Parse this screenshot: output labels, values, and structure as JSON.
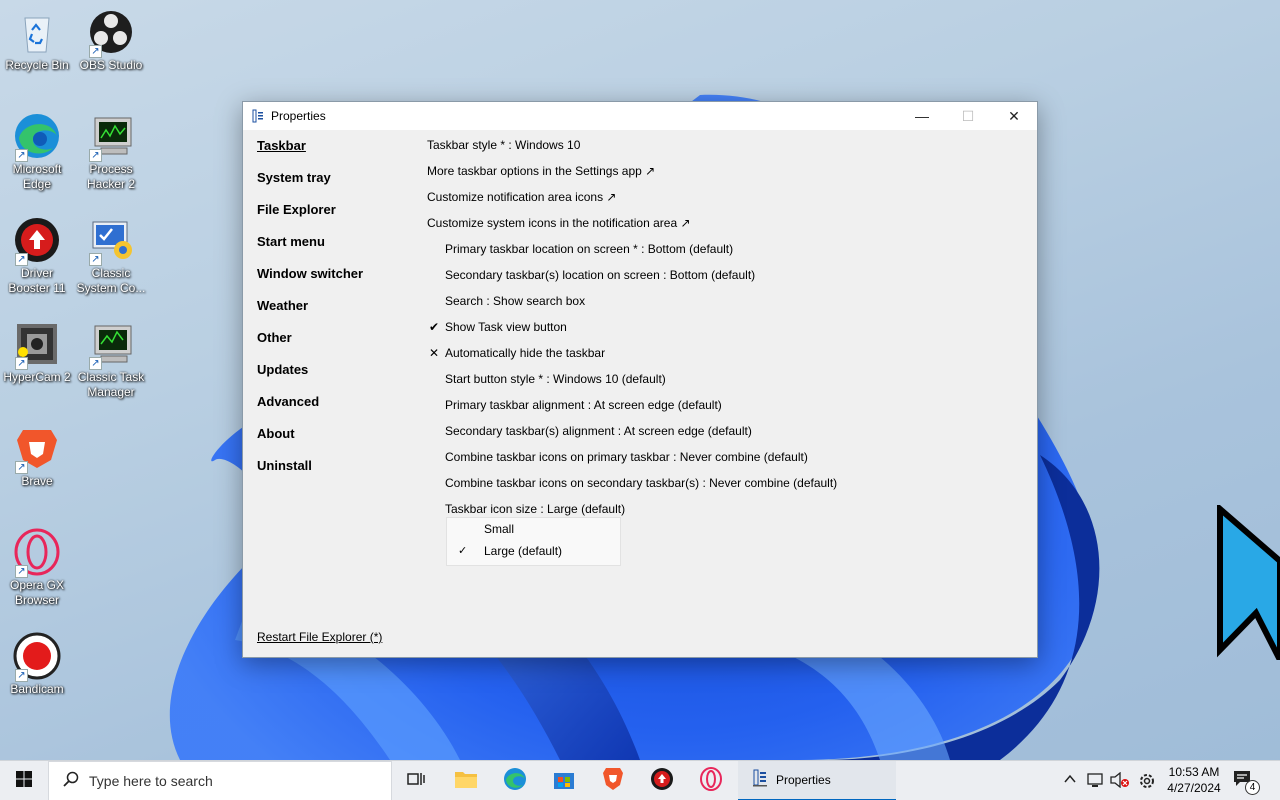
{
  "desktop": {
    "icons": [
      {
        "label": "Recycle Bin"
      },
      {
        "label": "OBS Studio"
      },
      {
        "label": "Microsoft Edge"
      },
      {
        "label": "Process Hacker 2"
      },
      {
        "label": "Driver Booster 11"
      },
      {
        "label": "Classic System Co..."
      },
      {
        "label": "HyperCam 2"
      },
      {
        "label": "Classic Task Manager"
      },
      {
        "label": "Brave"
      },
      {
        "label": "Opera GX Browser"
      },
      {
        "label": "Bandicam"
      }
    ]
  },
  "window": {
    "title": "Properties",
    "icon": "properties-app-icon",
    "controls": {
      "minimize": "—",
      "maximize": "☐",
      "close": "✕"
    },
    "nav": [
      {
        "label": "Taskbar",
        "active": true
      },
      {
        "label": "System tray"
      },
      {
        "label": "File Explorer"
      },
      {
        "label": "Start menu"
      },
      {
        "label": "Window switcher"
      },
      {
        "label": "Weather"
      },
      {
        "label": "Other"
      },
      {
        "label": "Updates"
      },
      {
        "label": "Advanced"
      },
      {
        "label": "About"
      },
      {
        "label": "Uninstall"
      }
    ],
    "settings": [
      {
        "label": "Taskbar style * : Windows 10"
      },
      {
        "label": "More taskbar options in the Settings app ↗"
      },
      {
        "label": "Customize notification area icons ↗"
      },
      {
        "label": "Customize system icons in the notification area ↗"
      },
      {
        "label": "Primary taskbar location on screen * : Bottom (default)"
      },
      {
        "label": "Secondary taskbar(s) location on screen : Bottom (default)"
      },
      {
        "label": "Search : Show search box"
      },
      {
        "label": "Show Task view button",
        "mark": "✔"
      },
      {
        "label": "Automatically hide the taskbar",
        "mark": "✕"
      },
      {
        "label": "Start button style * : Windows 10 (default)"
      },
      {
        "label": "Primary taskbar alignment : At screen edge (default)"
      },
      {
        "label": "Secondary taskbar(s) alignment : At screen edge (default)"
      },
      {
        "label": "Combine taskbar icons on primary taskbar : Never combine (default)"
      },
      {
        "label": "Combine taskbar icons on secondary taskbar(s) : Never combine (default)"
      },
      {
        "label": "Taskbar icon size : Large (default)"
      }
    ],
    "dropdown": {
      "options": [
        {
          "label": "Small",
          "checked": false
        },
        {
          "label": "Large (default)",
          "checked": true,
          "check": "✓"
        }
      ]
    },
    "restart_link": "Restart File Explorer (*)"
  },
  "taskbar": {
    "search_placeholder": "Type here to search",
    "active_window_label": "Properties",
    "clock": {
      "time": "10:53 AM",
      "date": "4/27/2024"
    },
    "notification_count": "4",
    "accent": "#0067c0"
  }
}
